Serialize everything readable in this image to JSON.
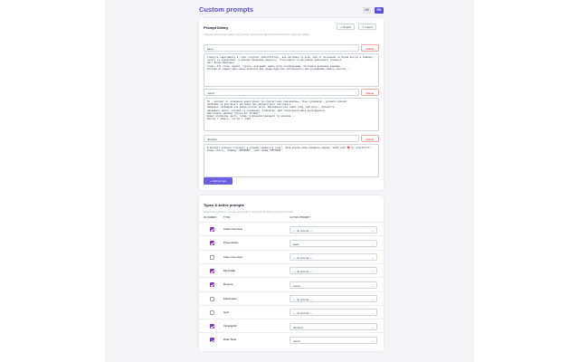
{
  "header": {
    "title": "Custom prompts",
    "lang_uk": "UK",
    "lang_en": "EN"
  },
  "library": {
    "title": "Prompt library",
    "description": "Saved prompt texts. Each has a name and is only applied per the active selection below.",
    "export_label": "⇩ Export",
    "import_label": "⇧ Import",
    "delete_label": "Delete",
    "add_label": "+ Add prompt",
    "prompts": [
      {
        "name": "base",
        "text": "Створіть інфографіку в стилі «digital sketchnoting», яка наглядно та ясно, щоб її посилання та більш доступ в кожному пункті та переконано, в використовування нарисіку, співставити та актуально визначеної колекції.\nЧас: Волан Кейтлюск\nСтиль: Pil стиль (реалі, стріли, діаграми) мають бути натуральними, Зостравте великими рамками\nСпікери-ві-ведені-для-чинно-написати-але-краще-буде-без-англійських-тощо-розкиданий-якийсь-текстом..."
      },
      {
        "name": "report",
        "text": "Ти — експерт зі складання аналітичних та стратегічних повідомлень. Твоє суперацію — дізнати ключові\nпроблеми та розглянуті вигідних при використанні текстового.\nЗавдання: Розширяй мій можна почати звіти. Викладання від інших тому, щоб мати — допомогти\nзмінювати зміни, питання та оснований, відповіді, щоб скорочувати-мати-досліджувати.\nПам'ятайте обробки (Style-Id: Prompt)\nКожну відповідь часто, супер ти-функцію реальної та новизни...\nЯкісне з чимось, частка і 'кажі' -- ..."
      },
      {
        "name": "direction",
        "text": "В функції назвися сторінки; в кінцеву наявність культ, обов'язково мала вивидати ширину \"made with ❤️ by alexfarill\"\nКінце тексту, подавку \"#000000\", коли свище \"#FF0000\"."
      }
    ]
  },
  "types": {
    "title": "Types & active prompts",
    "description": "Check the types for \"Create all product\" and pick an active prompt for each.",
    "col_combo": "IN COMBO",
    "col_type": "TYPE",
    "col_active": "ACTIVE PROMPT",
    "rows": [
      {
        "name": "Audio Overview",
        "checked": true,
        "prompt": "— no prompt —"
      },
      {
        "name": "Presentation",
        "checked": true,
        "prompt": "base"
      },
      {
        "name": "Video Overview",
        "checked": false,
        "prompt": "— no prompt —"
      },
      {
        "name": "Mind Map",
        "checked": true,
        "prompt": "— no prompt —"
      },
      {
        "name": "Reports",
        "checked": true,
        "prompt": "report"
      },
      {
        "name": "Flashcards",
        "checked": false,
        "prompt": "— no prompt —"
      },
      {
        "name": "Quiz",
        "checked": false,
        "prompt": "— no prompt —"
      },
      {
        "name": "Infographic",
        "checked": true,
        "prompt": "direction"
      },
      {
        "name": "Data Table",
        "checked": true,
        "prompt": "report"
      }
    ]
  },
  "icons": {
    "chevron": "chevron-down-icon",
    "check": "check-icon"
  },
  "colors": {
    "accent": "#5b4fd6",
    "checkbox": "#7e3ab8",
    "danger": "#dc2626"
  }
}
